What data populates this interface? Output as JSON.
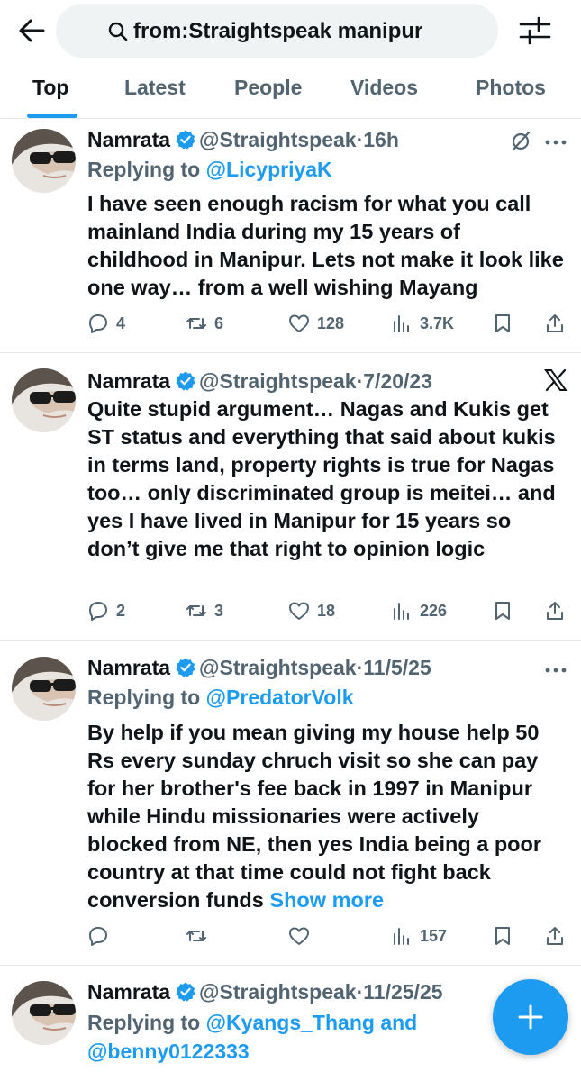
{
  "search": {
    "query": "from:Straightspeak manipur"
  },
  "tabs": [
    {
      "label": "Top",
      "active": true
    },
    {
      "label": "Latest",
      "active": false
    },
    {
      "label": "People",
      "active": false
    },
    {
      "label": "Videos",
      "active": false
    },
    {
      "label": "Photos",
      "active": false
    }
  ],
  "colors": {
    "accent": "#1d9bf0",
    "text": "#0f1419",
    "muted": "#536471",
    "divider": "#e6e9eb",
    "search_bg": "#eff3f4"
  },
  "icons": {
    "back": "arrow-left-icon",
    "search": "magnifier-icon",
    "filter": "sliders-icon",
    "verified": "verified-badge-icon",
    "reply": "speech-bubble-icon",
    "retweet": "retweet-icon",
    "like": "heart-icon",
    "views": "bar-chart-icon",
    "bookmark": "bookmark-icon",
    "share": "share-arrow-icon",
    "grok": "slashed-circle-icon",
    "x": "x-logo-icon",
    "compose": "plus-icon"
  },
  "tweets": [
    {
      "name": "Namrata",
      "handle": "@Straightspeak",
      "dot": "·",
      "time": "16h",
      "reply_prefix": "Replying to",
      "reply_to": "@LicypriyaK",
      "text": "I have seen enough racism for what you call mainland India during my 15 years of childhood in Manipur. Lets not make it look like one way… from a well wishing Mayang",
      "replies": "4",
      "retweets": "6",
      "likes": "128",
      "views": "3.7K"
    },
    {
      "name": "Namrata",
      "handle": "@Straightspeak",
      "dot": "·",
      "time": "7/20/23",
      "text": "Quite stupid argument… Nagas and Kukis get ST status and everything that said about kukis in terms land, property rights is true for Nagas too… only discriminated group is meitei… and yes I have lived in Manipur for 15 years so don’t give me that right to opinion logic",
      "replies": "2",
      "retweets": "3",
      "likes": "18",
      "views": "226"
    },
    {
      "name": "Namrata",
      "handle": "@Straightspeak",
      "dot": "·",
      "time": "11/5/25",
      "reply_prefix": "Replying to",
      "reply_to": "@PredatorVolk",
      "text": "By help if you mean giving my house help 50 Rs every sunday chruch visit so she can pay for her brother's fee back in 1997 in Manipur while Hindu missionaries were actively blocked from NE, then yes India being a poor country at that time could not fight back conversion funds",
      "show_more": "Show more",
      "views": "157"
    },
    {
      "name": "Namrata",
      "handle": "@Straightspeak",
      "dot": "·",
      "time": "11/25/25",
      "reply_prefix": "Replying to",
      "reply_to": "@Kyangs_Thang",
      "reply_joiner": "and",
      "reply_to_2": "@benny0122333"
    }
  ]
}
